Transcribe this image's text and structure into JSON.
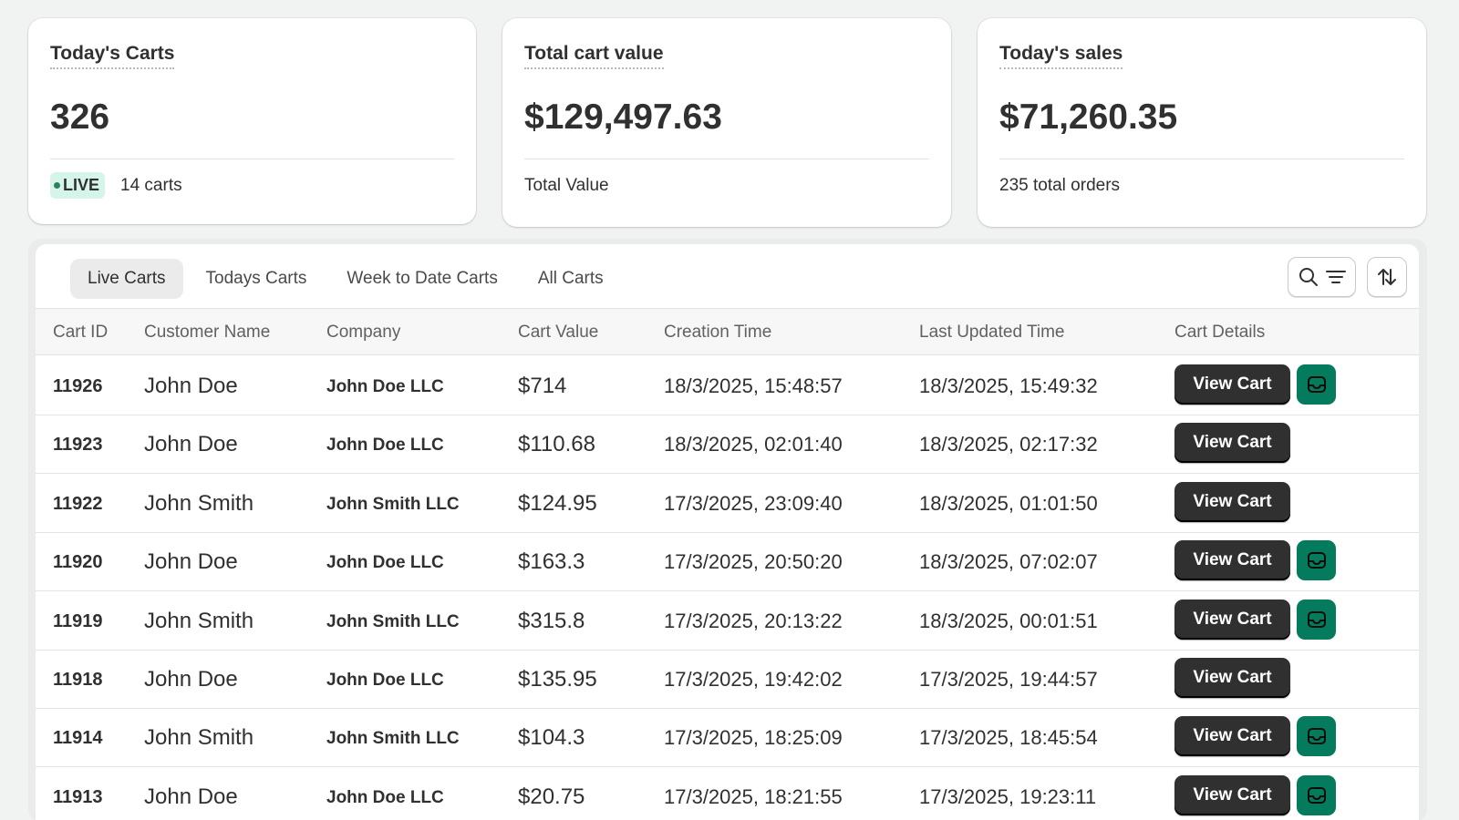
{
  "summary": {
    "carts": {
      "title": "Today's Carts",
      "value": "326",
      "badge": "LIVE",
      "foot": "14 carts"
    },
    "cart_value": {
      "title": "Total cart value",
      "value": "$129,497.63",
      "foot": "Total Value"
    },
    "sales": {
      "title": "Today's sales",
      "value": "$71,260.35",
      "foot": "235 total orders"
    }
  },
  "tabs": [
    {
      "label": "Live Carts",
      "active": true
    },
    {
      "label": "Todays Carts",
      "active": false
    },
    {
      "label": "Week to Date Carts",
      "active": false
    },
    {
      "label": "All Carts",
      "active": false
    }
  ],
  "toolbar": {
    "search_filter_icon": "search-filter-icon",
    "sort_icon": "sort-icon"
  },
  "columns": [
    "Cart ID",
    "Customer Name",
    "Company",
    "Cart Value",
    "Creation Time",
    "Last Updated Time",
    "Cart Details"
  ],
  "view_cart_label": "View Cart",
  "rows": [
    {
      "id": "11926",
      "customer": "John Doe",
      "company": "John Doe LLC",
      "value": "$714",
      "created": "18/3/2025, 15:48:57",
      "updated": "18/3/2025, 15:49:32",
      "inbox": true
    },
    {
      "id": "11923",
      "customer": "John Doe",
      "company": "John Doe LLC",
      "value": "$110.68",
      "created": "18/3/2025, 02:01:40",
      "updated": "18/3/2025, 02:17:32",
      "inbox": false
    },
    {
      "id": "11922",
      "customer": "John Smith",
      "company": "John Smith LLC",
      "value": "$124.95",
      "created": "17/3/2025, 23:09:40",
      "updated": "18/3/2025, 01:01:50",
      "inbox": false
    },
    {
      "id": "11920",
      "customer": "John Doe",
      "company": "John Doe LLC",
      "value": "$163.3",
      "created": "17/3/2025, 20:50:20",
      "updated": "18/3/2025, 07:02:07",
      "inbox": true
    },
    {
      "id": "11919",
      "customer": "John Smith",
      "company": "John Smith LLC",
      "value": "$315.8",
      "created": "17/3/2025, 20:13:22",
      "updated": "18/3/2025, 00:01:51",
      "inbox": true
    },
    {
      "id": "11918",
      "customer": "John Doe",
      "company": "John Doe LLC",
      "value": "$135.95",
      "created": "17/3/2025, 19:42:02",
      "updated": "17/3/2025, 19:44:57",
      "inbox": false
    },
    {
      "id": "11914",
      "customer": "John Smith",
      "company": "John Smith LLC",
      "value": "$104.3",
      "created": "17/3/2025, 18:25:09",
      "updated": "17/3/2025, 18:45:54",
      "inbox": true
    },
    {
      "id": "11913",
      "customer": "John Doe",
      "company": "John Doe LLC",
      "value": "$20.75",
      "created": "17/3/2025, 18:21:55",
      "updated": "17/3/2025, 19:23:11",
      "inbox": true
    }
  ],
  "colors": {
    "live_badge_bg": "#d6f5ea",
    "live_dot": "#29845a",
    "inbox_button": "#047b5d",
    "view_button": "#303030"
  }
}
